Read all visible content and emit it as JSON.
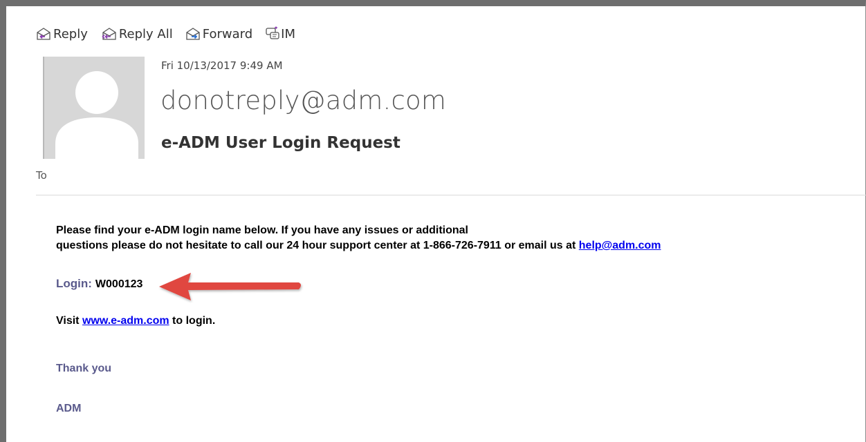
{
  "toolbar": {
    "reply_label": "Reply",
    "reply_all_label": "Reply All",
    "forward_label": "Forward",
    "im_label": "IM"
  },
  "message": {
    "timestamp": "Fri 10/13/2017 9:49 AM",
    "sender": "donotreply@adm.com",
    "subject": "e-ADM User Login Request",
    "to_label": "To"
  },
  "body": {
    "line1": "Please find your e-ADM login name below. If you have any issues or additional",
    "line2_text": "questions please do not hesitate to call our 24 hour support center at 1-866-726-7911 or email us at ",
    "line2_link": "help@adm.com",
    "login_label": "Login:",
    "login_value": "W000123",
    "visit_prefix": "Visit ",
    "visit_link": "www.e-adm.com",
    "visit_suffix": " to login.",
    "thanks": "Thank you",
    "signature": "ADM"
  },
  "colors": {
    "accent_purple": "#5a5a8c",
    "link_blue": "#0000ee",
    "annotation_arrow": "#e0463f"
  },
  "icons": [
    "reply-icon",
    "reply-all-icon",
    "forward-icon",
    "im-icon",
    "avatar-placeholder",
    "annotation-arrow"
  ]
}
